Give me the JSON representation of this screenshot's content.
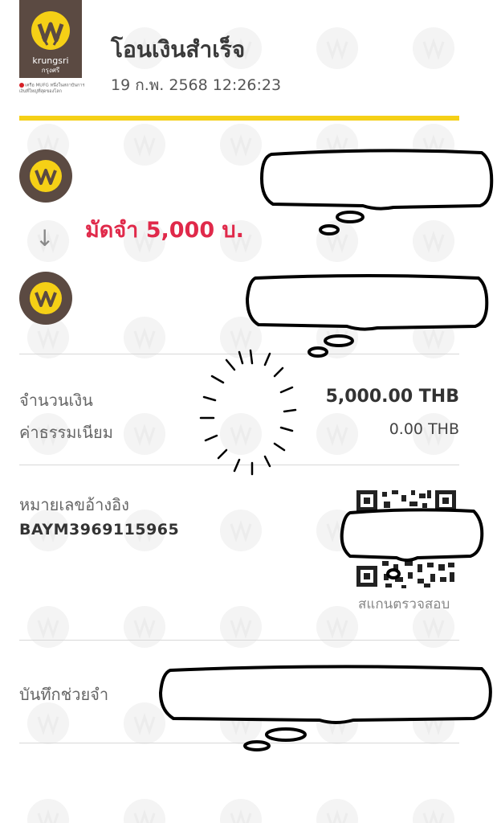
{
  "header": {
    "brand_name": "krungsri",
    "brand_name_th": "กรุงศรี",
    "mufg_note": "เครือ MUFG หนึ่งในสถาบันการเงินที่ใหญ่ที่สุดของโลก",
    "title": "โอนเงินสำเร็จ",
    "datetime": "19 ก.พ. 2568 12:26:23"
  },
  "transfer": {
    "note": "มัดจำ 5,000 บ.",
    "arrow": "↓"
  },
  "amounts": {
    "amount_label": "จำนวนเงิน",
    "amount_value": "5,000.00 THB",
    "fee_label": "ค่าธรรมเนียม",
    "fee_value": "0.00 THB"
  },
  "reference": {
    "label": "หมายเลขอ้างอิง",
    "value": "BAYM3969115965",
    "scan_label": "สแกนตรวจสอบ"
  },
  "memo": {
    "label": "บันทึกช่วยจำ"
  },
  "colors": {
    "brand_brown": "#5b4a42",
    "brand_yellow": "#f5d016",
    "note_red": "#e0294a"
  },
  "icons": {
    "logo": "krungsri-logo-icon",
    "arrow": "arrow-down-icon",
    "qr": "qr-code-icon"
  }
}
